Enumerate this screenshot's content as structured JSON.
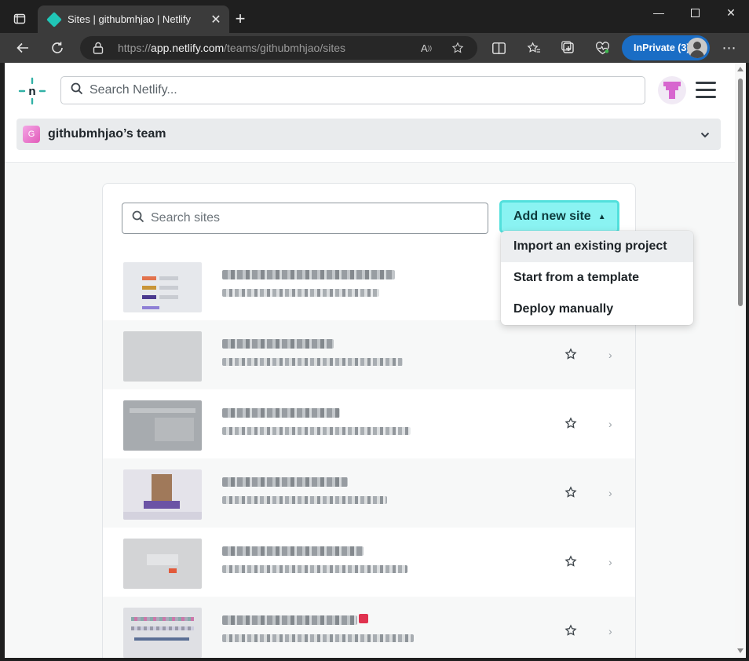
{
  "browser": {
    "tab_title": "Sites | githubmhjao | Netlify",
    "url_scheme": "https://",
    "url_host": "app.netlify.com",
    "url_path": "/teams/githubmhjao/sites",
    "inprivate_label": "InPrivate (3)"
  },
  "header": {
    "search_placeholder": "Search Netlify...",
    "team_initial": "G",
    "team_name": "githubmhjao’s team"
  },
  "sites": {
    "search_placeholder": "Search sites",
    "add_button_label": "Add new site",
    "dropdown_options": [
      "Import an existing project",
      "Start from a template",
      "Deploy manually"
    ],
    "row_count_visible": 6
  },
  "colors": {
    "accent_teal": "#8af3f2",
    "accent_border": "#52e0dc",
    "edge_inprivate": "#1a6dc5",
    "netlify_logo": "#32b1a6"
  }
}
